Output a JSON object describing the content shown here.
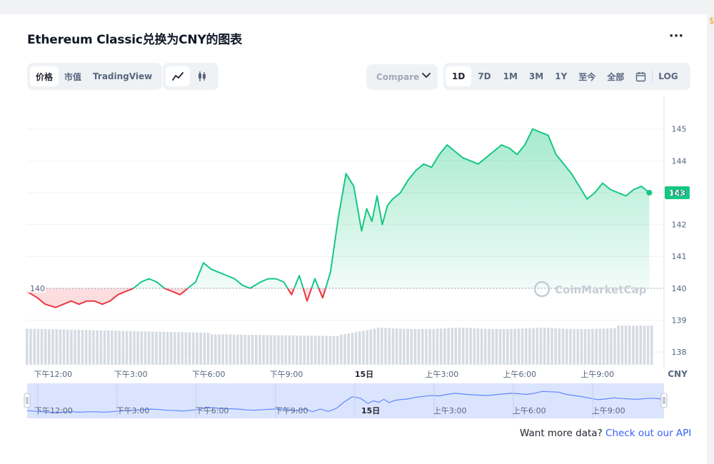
{
  "title": "Ethereum Classic兑换为CNY的图表",
  "menu_icon": "more-dots-icon",
  "view_tabs": [
    {
      "label": "价格",
      "active": true
    },
    {
      "label": "市值",
      "active": false
    },
    {
      "label": "TradingView",
      "active": false
    }
  ],
  "chart_type_toggle": [
    {
      "icon": "line-chart-icon",
      "active": true
    },
    {
      "icon": "candlestick-icon",
      "active": false
    }
  ],
  "compare": {
    "label": "Compare",
    "icon": "chevron-down-icon"
  },
  "range_tabs": [
    {
      "label": "1D",
      "active": true
    },
    {
      "label": "7D",
      "active": false
    },
    {
      "label": "1M",
      "active": false
    },
    {
      "label": "3M",
      "active": false
    },
    {
      "label": "1Y",
      "active": false
    },
    {
      "label": "至今",
      "active": false
    },
    {
      "label": "全部",
      "active": false
    },
    {
      "label": "",
      "icon": "calendar-icon",
      "active": false
    },
    {
      "label": "LOG",
      "active": false
    }
  ],
  "watermark": "CoinMarketCap",
  "footer": {
    "text": "Want more data?",
    "link": "Check out our API"
  },
  "colors": {
    "up": "#16c784",
    "down": "#ea3943",
    "accent": "#3861fb"
  },
  "chart_data": {
    "type": "line",
    "currency": "CNY",
    "reference_price": 140,
    "reference_label": "140",
    "current_price": 143,
    "current_label": "143",
    "y_ticks": [
      "145",
      "144",
      "143",
      "142",
      "141",
      "140",
      "139",
      "138"
    ],
    "y_range": [
      137.6,
      145.8
    ],
    "x_ticks": [
      "下午12:00",
      "下午3:00",
      "下午6:00",
      "下午9:00",
      "15日",
      "上午3:00",
      "上午6:00",
      "上午9:00"
    ],
    "x_range_hours": [
      -1.0,
      23.1
    ],
    "grid": true,
    "series": [
      {
        "x": [
          -1.0,
          -0.6,
          -0.3,
          0.1,
          0.4,
          0.7,
          1.0,
          1.3,
          1.6,
          1.9,
          2.2,
          2.5,
          2.8,
          3.1,
          3.4,
          3.7,
          4.0,
          4.3,
          4.6,
          4.9,
          5.2,
          5.5,
          5.8,
          6.1,
          6.4,
          6.7,
          7.0,
          7.3,
          7.6,
          8.0,
          8.3,
          8.6,
          8.9,
          9.2,
          9.5,
          9.8,
          10.1,
          10.4,
          10.7,
          11.0,
          11.3,
          11.6,
          11.9,
          12.1,
          12.3,
          12.5,
          12.7,
          12.9,
          13.1,
          13.4,
          13.7,
          14.0,
          14.3,
          14.6,
          14.9,
          15.2,
          15.5,
          15.8,
          16.1,
          16.4,
          16.7,
          17.0,
          17.3,
          17.6,
          17.9,
          18.2,
          18.5,
          18.8,
          19.1,
          19.4,
          19.7,
          20.0,
          20.3,
          20.6,
          20.9,
          21.2,
          21.5,
          21.8,
          22.1,
          22.4,
          22.7,
          23.0
        ],
        "y": [
          139.9,
          139.7,
          139.5,
          139.4,
          139.5,
          139.6,
          139.5,
          139.6,
          139.6,
          139.5,
          139.6,
          139.8,
          139.9,
          140.0,
          140.2,
          140.3,
          140.2,
          140.0,
          139.9,
          139.8,
          140.0,
          140.2,
          140.8,
          140.6,
          140.5,
          140.4,
          140.3,
          140.1,
          140.0,
          140.2,
          140.3,
          140.3,
          140.2,
          139.8,
          140.4,
          139.6,
          140.3,
          139.7,
          140.5,
          142.2,
          143.6,
          143.2,
          141.8,
          142.5,
          142.1,
          142.9,
          142.0,
          142.6,
          142.8,
          143.0,
          143.4,
          143.7,
          143.9,
          143.8,
          144.2,
          144.5,
          144.3,
          144.1,
          144.0,
          143.9,
          144.1,
          144.3,
          144.5,
          144.4,
          144.2,
          144.5,
          145.0,
          144.9,
          144.8,
          144.2,
          143.9,
          143.6,
          143.2,
          142.8,
          143.0,
          143.3,
          143.1,
          143.0,
          142.9,
          143.1,
          143.2,
          143.0
        ]
      }
    ],
    "volume_label": "",
    "navigator_x_ticks": [
      "下午12:00",
      "下午3:00",
      "下午6:00",
      "下午9:00",
      "15日",
      "上午3:00",
      "上午6:00",
      "上午9:00"
    ]
  }
}
